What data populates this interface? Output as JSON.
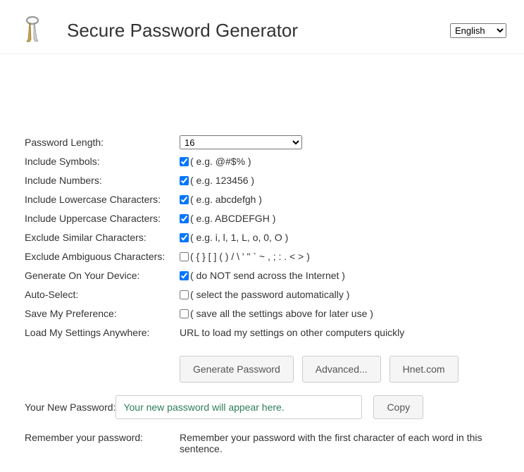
{
  "header": {
    "title": "Secure Password Generator",
    "language": "English"
  },
  "fields": {
    "length": {
      "label": "Password Length:",
      "value": "16"
    },
    "symbols": {
      "label": "Include Symbols:",
      "hint": "( e.g. @#$% )",
      "checked": true
    },
    "numbers": {
      "label": "Include Numbers:",
      "hint": "( e.g. 123456 )",
      "checked": true
    },
    "lowercase": {
      "label": "Include Lowercase Characters:",
      "hint": "( e.g. abcdefgh )",
      "checked": true
    },
    "uppercase": {
      "label": "Include Uppercase Characters:",
      "hint": "( e.g. ABCDEFGH )",
      "checked": true
    },
    "similar": {
      "label": "Exclude Similar Characters:",
      "hint": "( e.g. i, l, 1, L, o, 0, O )",
      "checked": true
    },
    "ambiguous": {
      "label": "Exclude Ambiguous Characters:",
      "hint": "( { } [ ] ( ) / \\ ' \" ` ~ , ; : . < > )",
      "checked": false
    },
    "device": {
      "label": "Generate On Your Device:",
      "hint": "( do NOT send across the Internet )",
      "checked": true
    },
    "autoselect": {
      "label": "Auto-Select:",
      "hint": "( select the password automatically )",
      "checked": false
    },
    "save": {
      "label": "Save My Preference:",
      "hint": "( save all the settings above for later use )",
      "checked": false
    },
    "load": {
      "label": "Load My Settings Anywhere:",
      "text": "URL to load my settings on other computers quickly"
    }
  },
  "buttons": {
    "generate": "Generate Password",
    "advanced": "Advanced...",
    "hnet": "Hnet.com"
  },
  "output": {
    "label": "Your New Password:",
    "placeholder": "Your new password will appear here.",
    "copy": "Copy"
  },
  "remember": {
    "label": "Remember your password:",
    "text": "Remember your password with the first character of each word in this sentence."
  }
}
